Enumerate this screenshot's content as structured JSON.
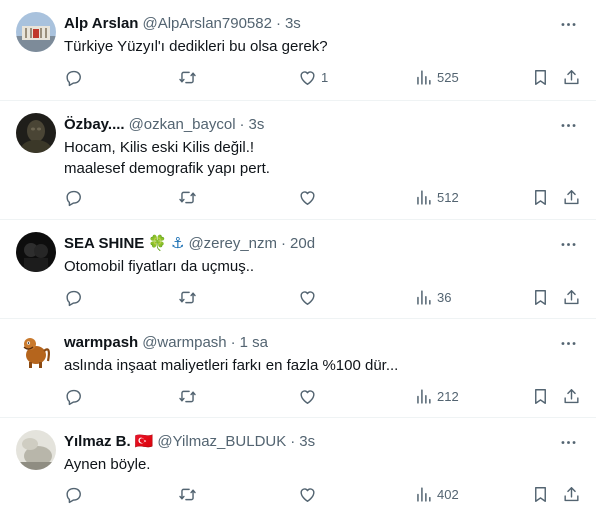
{
  "tweets": [
    {
      "name": "Alp Arslan",
      "handle": "@AlpArslan790582",
      "dot": "·",
      "time": "3s",
      "lines": [
        "Türkiye Yüzyıl'ı dedikleri bu olsa gerek?"
      ],
      "likes": "1",
      "views": "525",
      "avatar_colors": [
        "#9fb7d6",
        "#c0392b"
      ]
    },
    {
      "name": "Özbay....",
      "handle": "@ozkan_baycol",
      "dot": "·",
      "time": "3s",
      "lines": [
        "Hocam, Kilis eski Kilis değil.!",
        "maalesef demografik yapı pert."
      ],
      "likes": "",
      "views": "512",
      "avatar_colors": [
        "#2b2a24",
        "#5c5640"
      ]
    },
    {
      "name": "SEA SHINE",
      "emoji1": "🍀",
      "emoji2": "⚓",
      "handle": "@zerey_nzm",
      "dot": "·",
      "time": "20d",
      "lines": [
        "Otomobil fiyatları da uçmuş.."
      ],
      "likes": "",
      "views": "36",
      "avatar_colors": [
        "#111111",
        "#3a3a3a"
      ]
    },
    {
      "name": "warmpash",
      "handle": "@warmpash",
      "dot": "·",
      "time": "1 sa",
      "lines": [
        "aslında inşaat maliyetleri farkı en fazla %100 dür..."
      ],
      "likes": "",
      "views": "212",
      "avatar_colors": [
        "#ffffff",
        "#b5651d"
      ]
    },
    {
      "name": "Yılmaz B.",
      "flag": "🇹🇷",
      "handle": "@Yilmaz_BULDUK",
      "dot": "·",
      "time": "3s",
      "lines": [
        "Aynen böyle."
      ],
      "likes": "",
      "views": "402",
      "avatar_colors": [
        "#d8d8d0",
        "#9a9a90"
      ]
    }
  ],
  "icons": {
    "more": "more-icon",
    "reply": "reply-icon",
    "retweet": "retweet-icon",
    "like": "heart-icon",
    "views": "views-icon",
    "bookmark": "bookmark-icon",
    "share": "share-icon"
  },
  "colors": {
    "text": "#0f1419",
    "secondary": "#536471",
    "divider": "#eff3f4",
    "flag_red": "#e30a17"
  }
}
